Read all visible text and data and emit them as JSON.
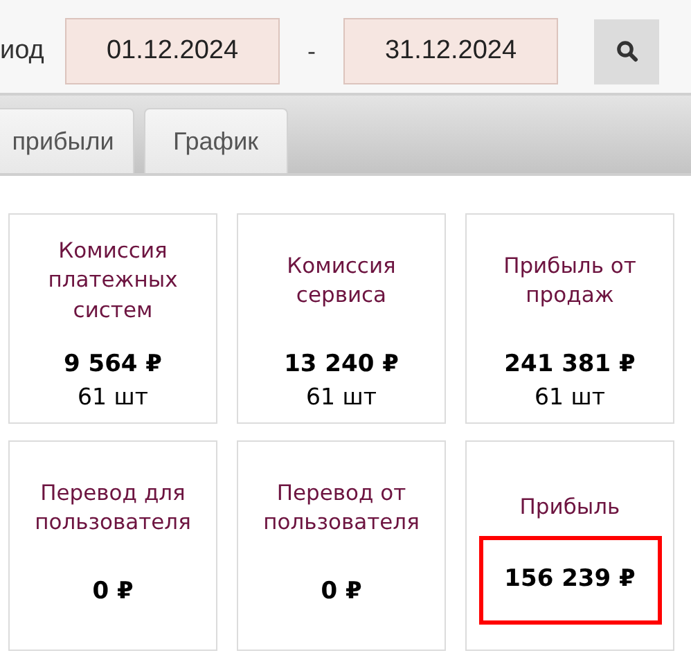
{
  "filter": {
    "label": "иод",
    "date_from": "01.12.2024",
    "separator": "-",
    "date_to": "31.12.2024"
  },
  "tabs": [
    {
      "label": "прибыли"
    },
    {
      "label": "График"
    }
  ],
  "cards": [
    {
      "title": "Комиссия платежных систем",
      "value": "9 564 ₽",
      "count": "61 шт",
      "highlighted": false
    },
    {
      "title": "Комиссия сервиса",
      "value": "13 240 ₽",
      "count": "61 шт",
      "highlighted": false
    },
    {
      "title": "Прибыль от продаж",
      "value": "241 381 ₽",
      "count": "61 шт",
      "highlighted": false
    },
    {
      "title": "Перевод для пользователя",
      "value": "0 ₽",
      "highlighted": false
    },
    {
      "title": "Перевод от пользователя",
      "value": "0 ₽",
      "highlighted": false
    },
    {
      "title": "Прибыль",
      "value": "156 239 ₽",
      "highlighted": true
    }
  ]
}
